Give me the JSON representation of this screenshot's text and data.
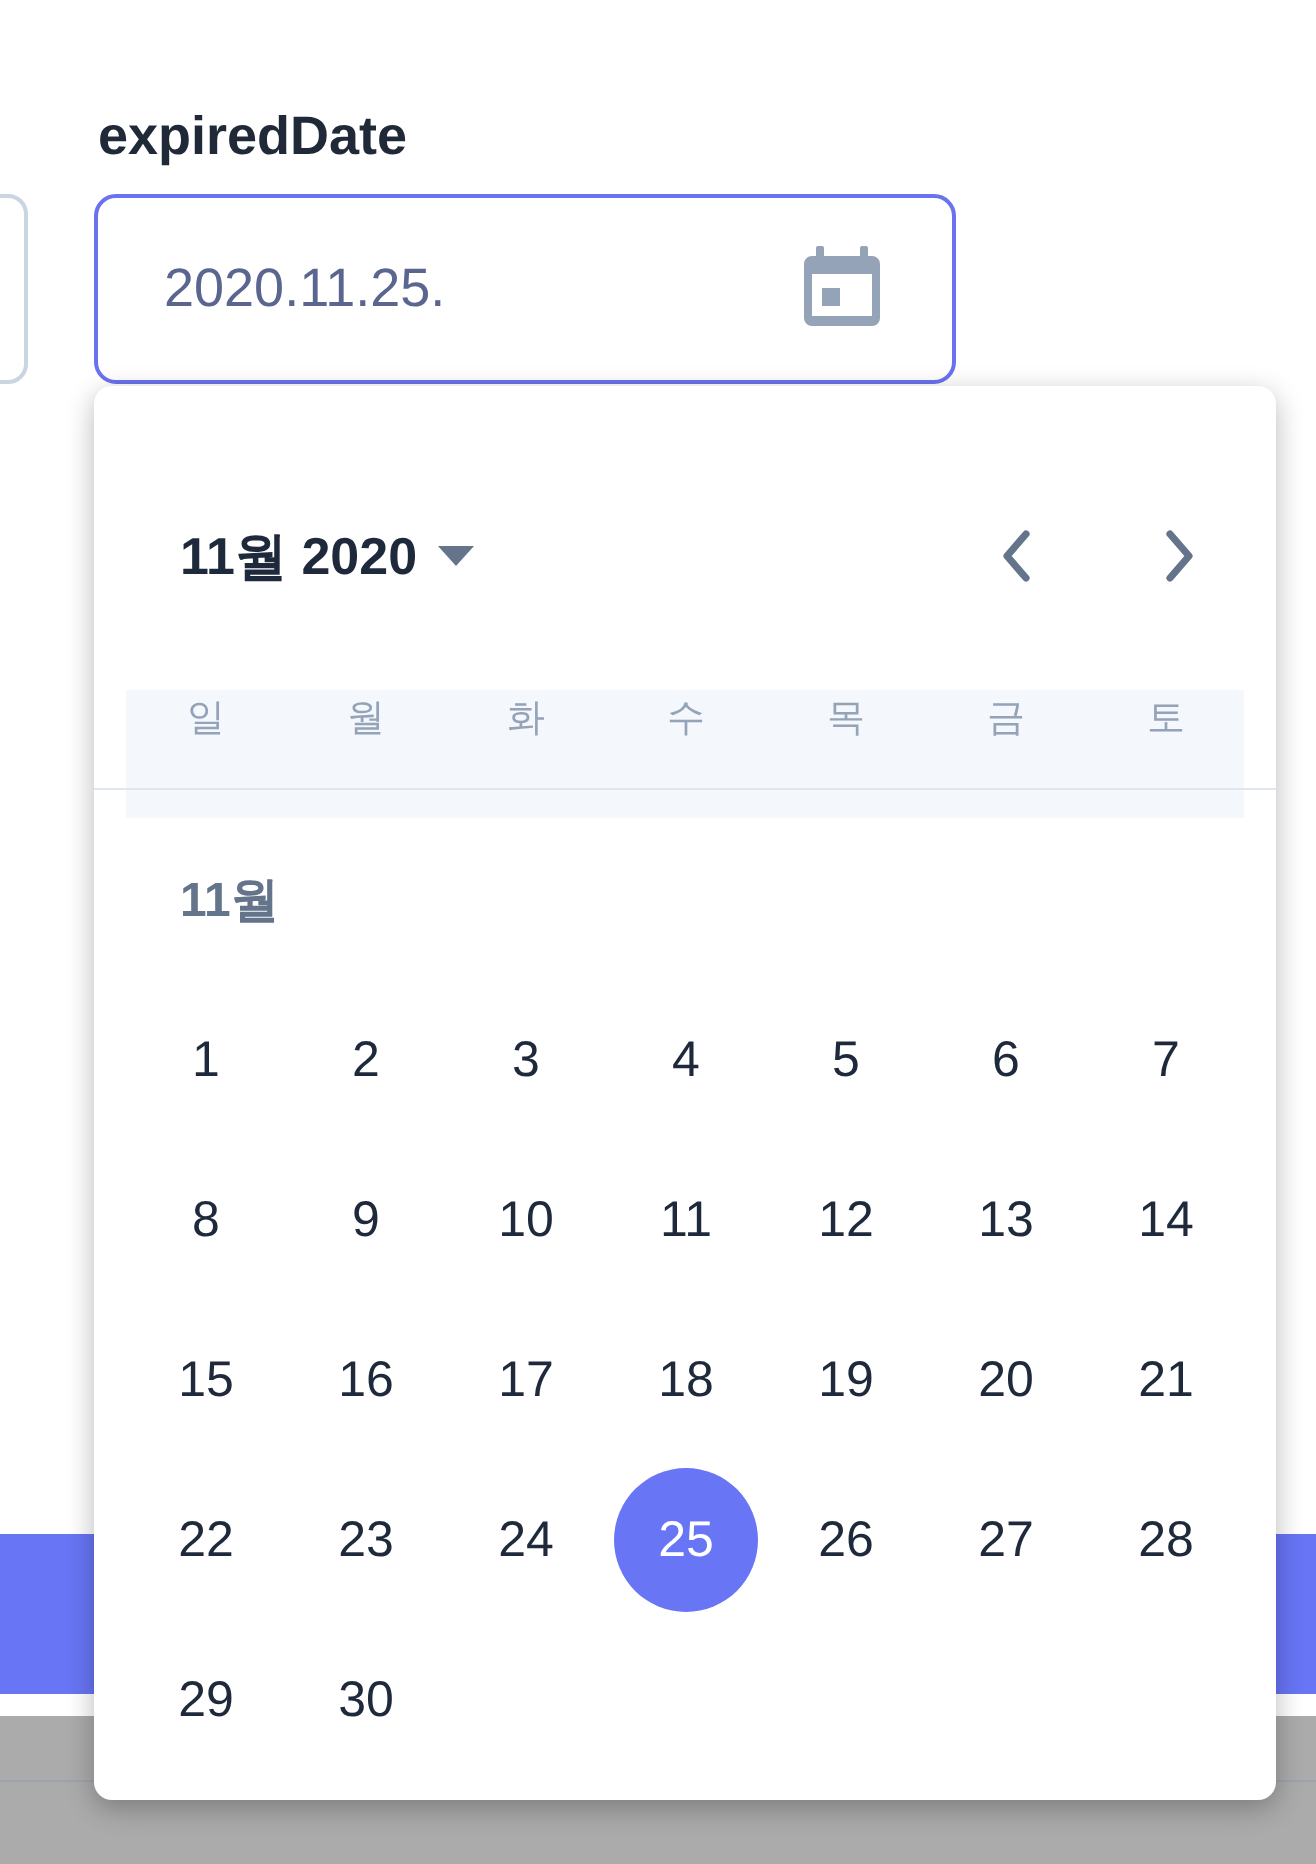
{
  "field": {
    "label": "expiredDate",
    "value": "2020.11.25."
  },
  "datepicker": {
    "title": "11월 2020",
    "weekdays": [
      "일",
      "월",
      "화",
      "수",
      "목",
      "금",
      "토"
    ],
    "month_label": "11월",
    "days": [
      {
        "label": "1",
        "selected": false
      },
      {
        "label": "2",
        "selected": false
      },
      {
        "label": "3",
        "selected": false
      },
      {
        "label": "4",
        "selected": false
      },
      {
        "label": "5",
        "selected": false
      },
      {
        "label": "6",
        "selected": false
      },
      {
        "label": "7",
        "selected": false
      },
      {
        "label": "8",
        "selected": false
      },
      {
        "label": "9",
        "selected": false
      },
      {
        "label": "10",
        "selected": false
      },
      {
        "label": "11",
        "selected": false
      },
      {
        "label": "12",
        "selected": false
      },
      {
        "label": "13",
        "selected": false
      },
      {
        "label": "14",
        "selected": false
      },
      {
        "label": "15",
        "selected": false
      },
      {
        "label": "16",
        "selected": false
      },
      {
        "label": "17",
        "selected": false
      },
      {
        "label": "18",
        "selected": false
      },
      {
        "label": "19",
        "selected": false
      },
      {
        "label": "20",
        "selected": false
      },
      {
        "label": "21",
        "selected": false
      },
      {
        "label": "22",
        "selected": false
      },
      {
        "label": "23",
        "selected": false
      },
      {
        "label": "24",
        "selected": false
      },
      {
        "label": "25",
        "selected": true
      },
      {
        "label": "26",
        "selected": false
      },
      {
        "label": "27",
        "selected": false
      },
      {
        "label": "28",
        "selected": false
      },
      {
        "label": "29",
        "selected": false
      },
      {
        "label": "30",
        "selected": false
      }
    ]
  }
}
